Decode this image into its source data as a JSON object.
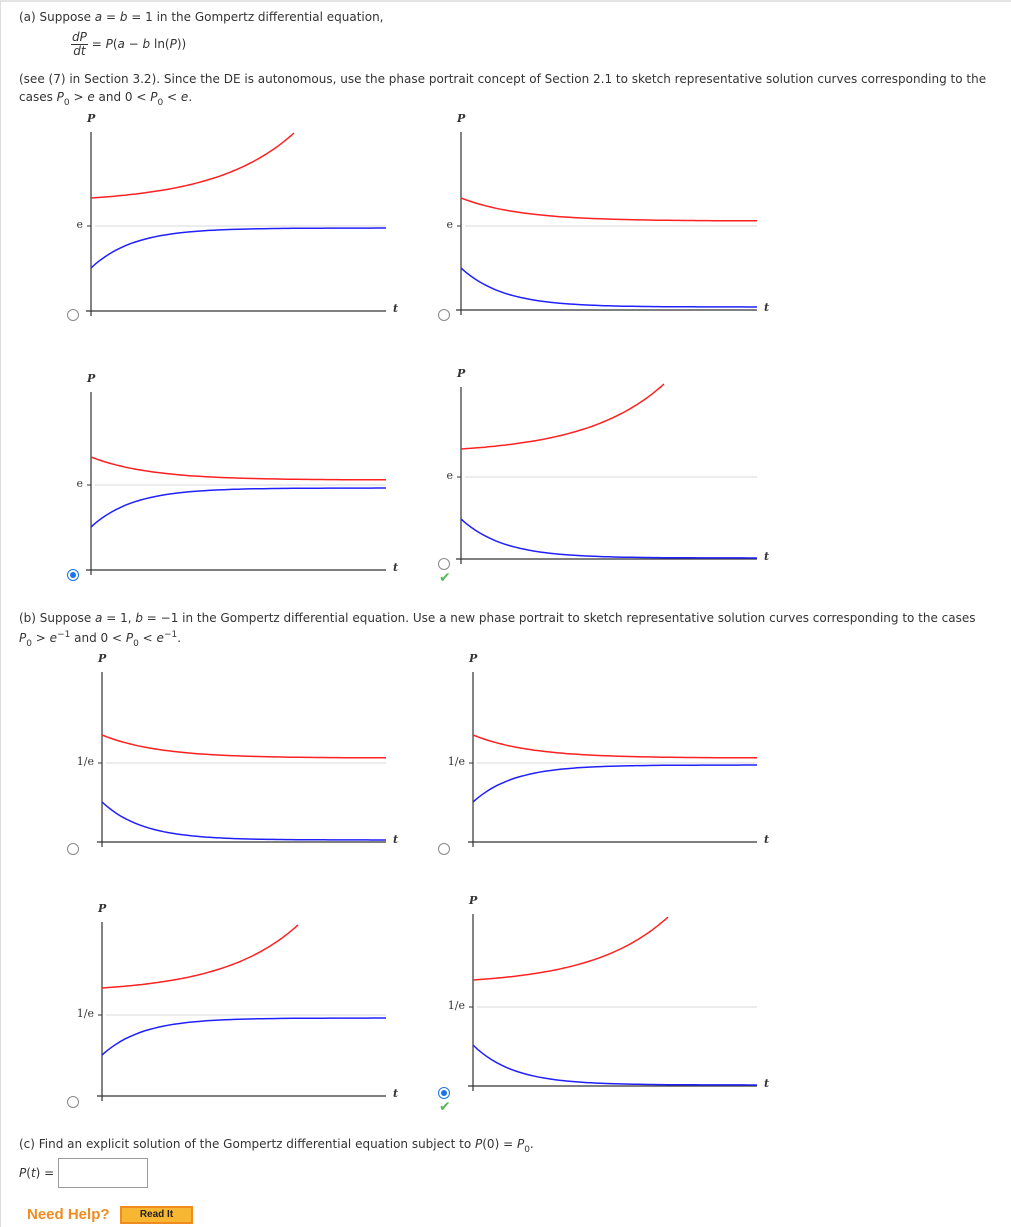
{
  "part_a": {
    "intro": "(a) Suppose a = b = 1 in the Gompertz differential equation,",
    "eq_num": "dP",
    "eq_den": "dt",
    "eq_rhs": "= P(a − b ln(P))",
    "text_1": "(see (7) in Section 3.2). Since the DE is autonomous, use the phase portrait concept of Section 2.1 to sketch representative solution curves corresponding to the",
    "text_2": "cases P0 > e and 0 < P0 < e."
  },
  "part_b": {
    "text_1": "(b) Suppose a = 1, b = −1 in the Gompertz differential equation. Use a new phase portrait to sketch representative solution curves corresponding to the cases",
    "text_2": "P0 > e−1 and 0 < P0 < e−1."
  },
  "part_c": {
    "text": "(c) Find an explicit solution of the Gompertz differential equation subject to P(0) = P0.",
    "answer_label": "P(t) =",
    "answer_value": ""
  },
  "help": {
    "label": "Need Help?",
    "read_it": "Read It"
  },
  "colors": {
    "upper_curve": "#ff2020",
    "lower_curve": "#2020ff",
    "equilibrium_line": "#d8d8d8",
    "radio_selected": "#1a73e8",
    "check": "#5cb85c"
  },
  "graphs": [
    {
      "part": "a",
      "y_label": "P",
      "x_label": "t",
      "level_label": "e",
      "upper": "increasing",
      "lower": "increasing",
      "selected": false,
      "correct": false
    },
    {
      "part": "a",
      "y_label": "P",
      "x_label": "t",
      "level_label": "e",
      "upper": "decreasing",
      "lower": "decreasing",
      "selected": false,
      "correct": false
    },
    {
      "part": "a",
      "y_label": "P",
      "x_label": "t",
      "level_label": "e",
      "upper": "decreasing",
      "lower": "increasing",
      "selected": true,
      "correct": false
    },
    {
      "part": "a",
      "y_label": "P",
      "x_label": "t",
      "level_label": "e",
      "upper": "increasing",
      "lower": "decreasing",
      "selected": false,
      "correct": true
    },
    {
      "part": "b",
      "y_label": "P",
      "x_label": "t",
      "level_label": "1/e",
      "upper": "decreasing",
      "lower": "decreasing",
      "selected": false,
      "correct": false
    },
    {
      "part": "b",
      "y_label": "P",
      "x_label": "t",
      "level_label": "1/e",
      "upper": "decreasing",
      "lower": "increasing",
      "selected": false,
      "correct": false
    },
    {
      "part": "b",
      "y_label": "P",
      "x_label": "t",
      "level_label": "1/e",
      "upper": "increasing",
      "lower": "increasing",
      "selected": false,
      "correct": false
    },
    {
      "part": "b",
      "y_label": "P",
      "x_label": "t",
      "level_label": "1/e",
      "upper": "increasing",
      "lower": "decreasing",
      "selected": true,
      "correct": true
    }
  ]
}
